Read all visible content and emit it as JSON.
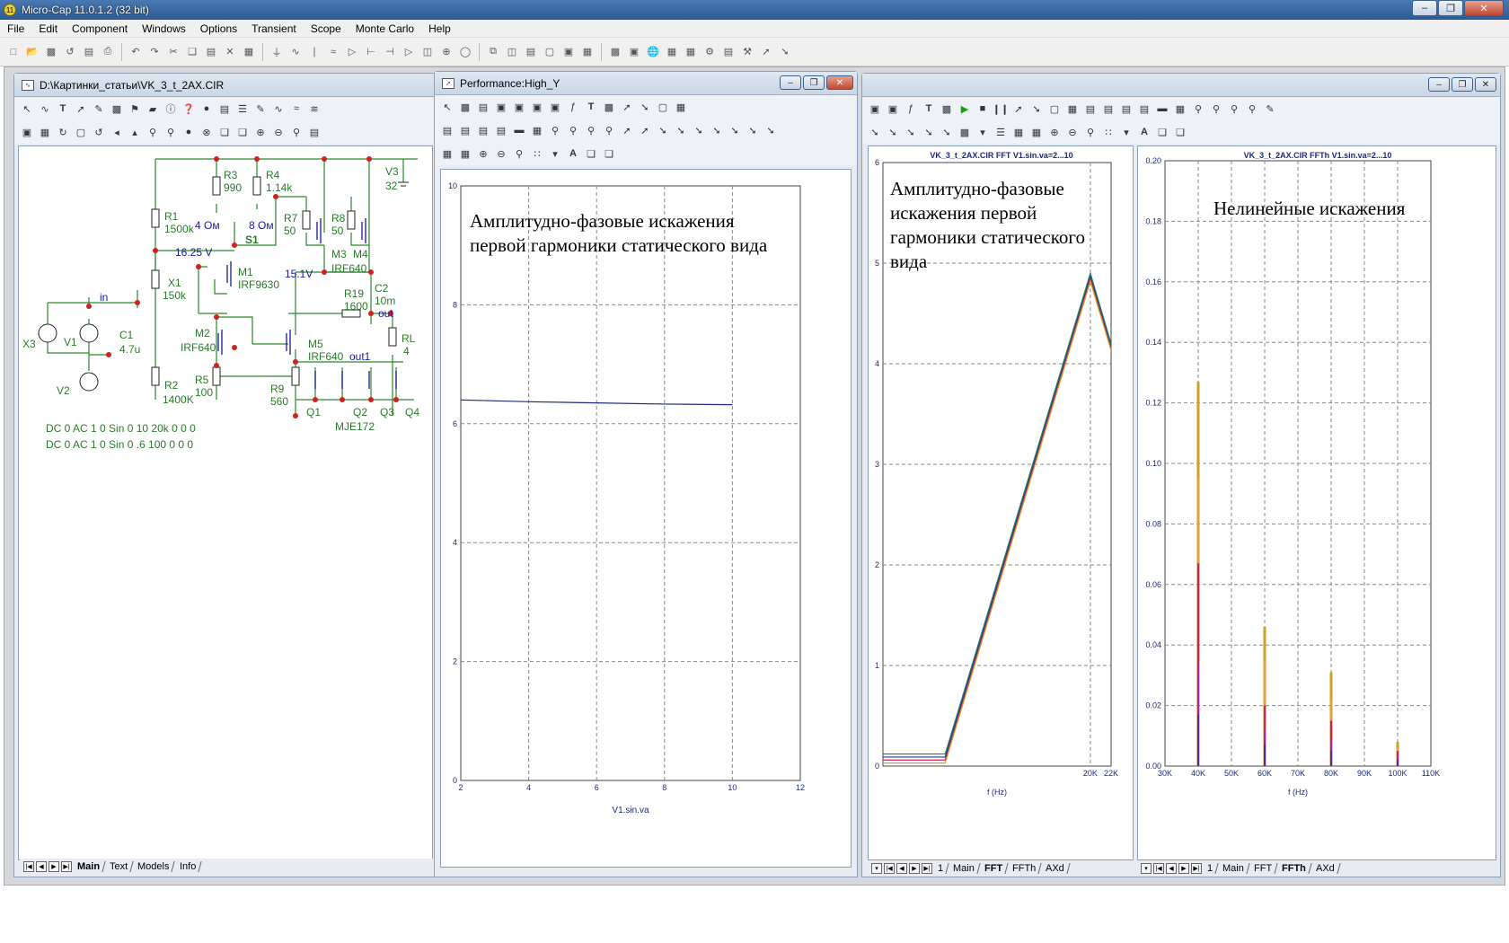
{
  "app": {
    "title": "Micro-Cap 11.0.1.2 (32 bit)",
    "icon": "micro-cap-icon"
  },
  "menu": [
    "File",
    "Edit",
    "Component",
    "Windows",
    "Options",
    "Transient",
    "Scope",
    "Monte Carlo",
    "Help"
  ],
  "schematic": {
    "title": "D:\\Картинки_статьи\\VK_3_t_2AX.CIR",
    "tabs": [
      "Main",
      "Text",
      "Models",
      "Info"
    ],
    "active_tab": "Main",
    "labels": {
      "r3": "R3",
      "r3v": "990",
      "r4": "R4",
      "r4v": "1.14k",
      "v3": "V3",
      "v3v": "32",
      "r1": "R1",
      "r1v": "1500k",
      "ohm4": "4 Ом",
      "ohm8": "8 Ом",
      "s1": "S1",
      "r7": "R7",
      "r7v": "50",
      "r8": "R8",
      "r8v": "50",
      "m3": "M3",
      "m4": "M4",
      "irf640a": "IRF640",
      "v1625": "16.25 V",
      "x1": "X1",
      "x1v": "150k",
      "m1": "M1",
      "irf9630": "IRF9630",
      "v151": "15.1V",
      "c2": "C2",
      "c2v": "10m",
      "r19": "R19",
      "r19v": "1600",
      "out": "out",
      "in": "in",
      "c1": "C1",
      "c1v": "4.7u",
      "x3": "X3",
      "v1": "V1",
      "m2": "M2",
      "irf640b": "IRF640",
      "m5": "M5",
      "irf640c": "IRF640",
      "rl": "RL",
      "rlv": "4",
      "out1": "out1",
      "r5": "R5",
      "r5v": "100",
      "r2": "R2",
      "r2v": "1400K",
      "v2": "V2",
      "r9": "R9",
      "r9v": "560",
      "q1": "Q1",
      "q2": "Q2",
      "q3": "Q3",
      "q4": "Q4",
      "mje": "MJE172",
      "src1": "DC 0 AC 1 0 Sin 0 10 20k 0 0 0",
      "src2": "DC 0 AC 1 0 Sin 0 .6 100 0 0 0"
    }
  },
  "performance": {
    "title": "Performance:High_Y",
    "annotation_line1": "Амплитудно-фазовые искажения",
    "annotation_line2": "первой гармоники статического вида",
    "chart_data": {
      "type": "line",
      "xlabel": "V1.sin.va",
      "xlim": [
        2,
        12
      ],
      "ylim": [
        0,
        10
      ],
      "x_ticks": [
        "2",
        "4",
        "6",
        "8",
        "10",
        "12"
      ],
      "y_ticks": [
        "0",
        "2",
        "4",
        "6",
        "8",
        "10"
      ],
      "series": [
        {
          "x": [
            2,
            4,
            6,
            8,
            10
          ],
          "values": [
            6.4,
            6.37,
            6.35,
            6.33,
            6.32
          ],
          "color": "#1a2a80"
        }
      ]
    }
  },
  "fft": {
    "header": "VK_3_t_2AX.CIR FFT V1.sin.va=2...10",
    "annotation_line1": "Амплитудно-фазовые",
    "annotation_line2": "искажения первой",
    "annotation_line3": "гармоники статического",
    "annotation_line4": "вида",
    "tabs": [
      "1",
      "Main",
      "FFT",
      "FFTh",
      "AXd"
    ],
    "active_tab": "FFT",
    "chart_data": {
      "type": "line",
      "xlabel": "f (Hz)",
      "xlim": [
        0,
        22000
      ],
      "ylim": [
        0,
        6
      ],
      "x_ticks": [
        {
          "v": 20000,
          "label": "20K"
        },
        {
          "v": 22000,
          "label": "22K"
        }
      ],
      "y_ticks": [
        "0",
        "1",
        "2",
        "3",
        "4",
        "5",
        "6"
      ],
      "series": [
        {
          "x": [
            0,
            6000,
            20000,
            34000
          ],
          "values": [
            0.06,
            0.06,
            4.85,
            0
          ],
          "color": "#d02050"
        },
        {
          "x": [
            0,
            6000,
            20000,
            34000
          ],
          "values": [
            0.09,
            0.09,
            4.88,
            0
          ],
          "color": "#2030a0"
        },
        {
          "x": [
            0,
            6000,
            20000,
            34000
          ],
          "values": [
            0.12,
            0.12,
            4.9,
            0
          ],
          "color": "#208060"
        },
        {
          "x": [
            0,
            6000,
            20000,
            34000
          ],
          "values": [
            0.03,
            0.03,
            4.82,
            0
          ],
          "color": "#d0a020"
        }
      ]
    }
  },
  "ffth": {
    "header": "VK_3_t_2AX.CIR FFTh V1.sin.va=2...10",
    "annotation": "Нелинейные искажения",
    "tabs": [
      "1",
      "Main",
      "FFT",
      "FFTh",
      "AXd"
    ],
    "active_tab": "FFTh",
    "chart_data": {
      "type": "bar",
      "xlabel": "f (Hz)",
      "xlim": [
        30000,
        110000
      ],
      "ylim": [
        0,
        0.2
      ],
      "x_ticks": [
        "30K",
        "40K",
        "50K",
        "60K",
        "70K",
        "80K",
        "90K",
        "100K",
        "110K"
      ],
      "y_ticks": [
        "0.00",
        "0.02",
        "0.04",
        "0.06",
        "0.08",
        "0.10",
        "0.12",
        "0.14",
        "0.16",
        "0.18",
        "0.20"
      ],
      "x": [
        40000,
        60000,
        80000,
        100000
      ],
      "series": [
        {
          "values": [
            0.127,
            0.046,
            0.031,
            0.008
          ],
          "color": "#d0a020"
        },
        {
          "values": [
            0.095,
            0.035,
            0.022,
            0.006
          ],
          "color": "#e0a040"
        },
        {
          "values": [
            0.067,
            0.02,
            0.015,
            0.005
          ],
          "color": "#d02050"
        },
        {
          "values": [
            0.034,
            0.012,
            0.008,
            0.003
          ],
          "color": "#a020c0"
        },
        {
          "values": [
            0.017,
            0.007,
            0.005,
            0.002
          ],
          "color": "#2030a0"
        }
      ]
    }
  }
}
